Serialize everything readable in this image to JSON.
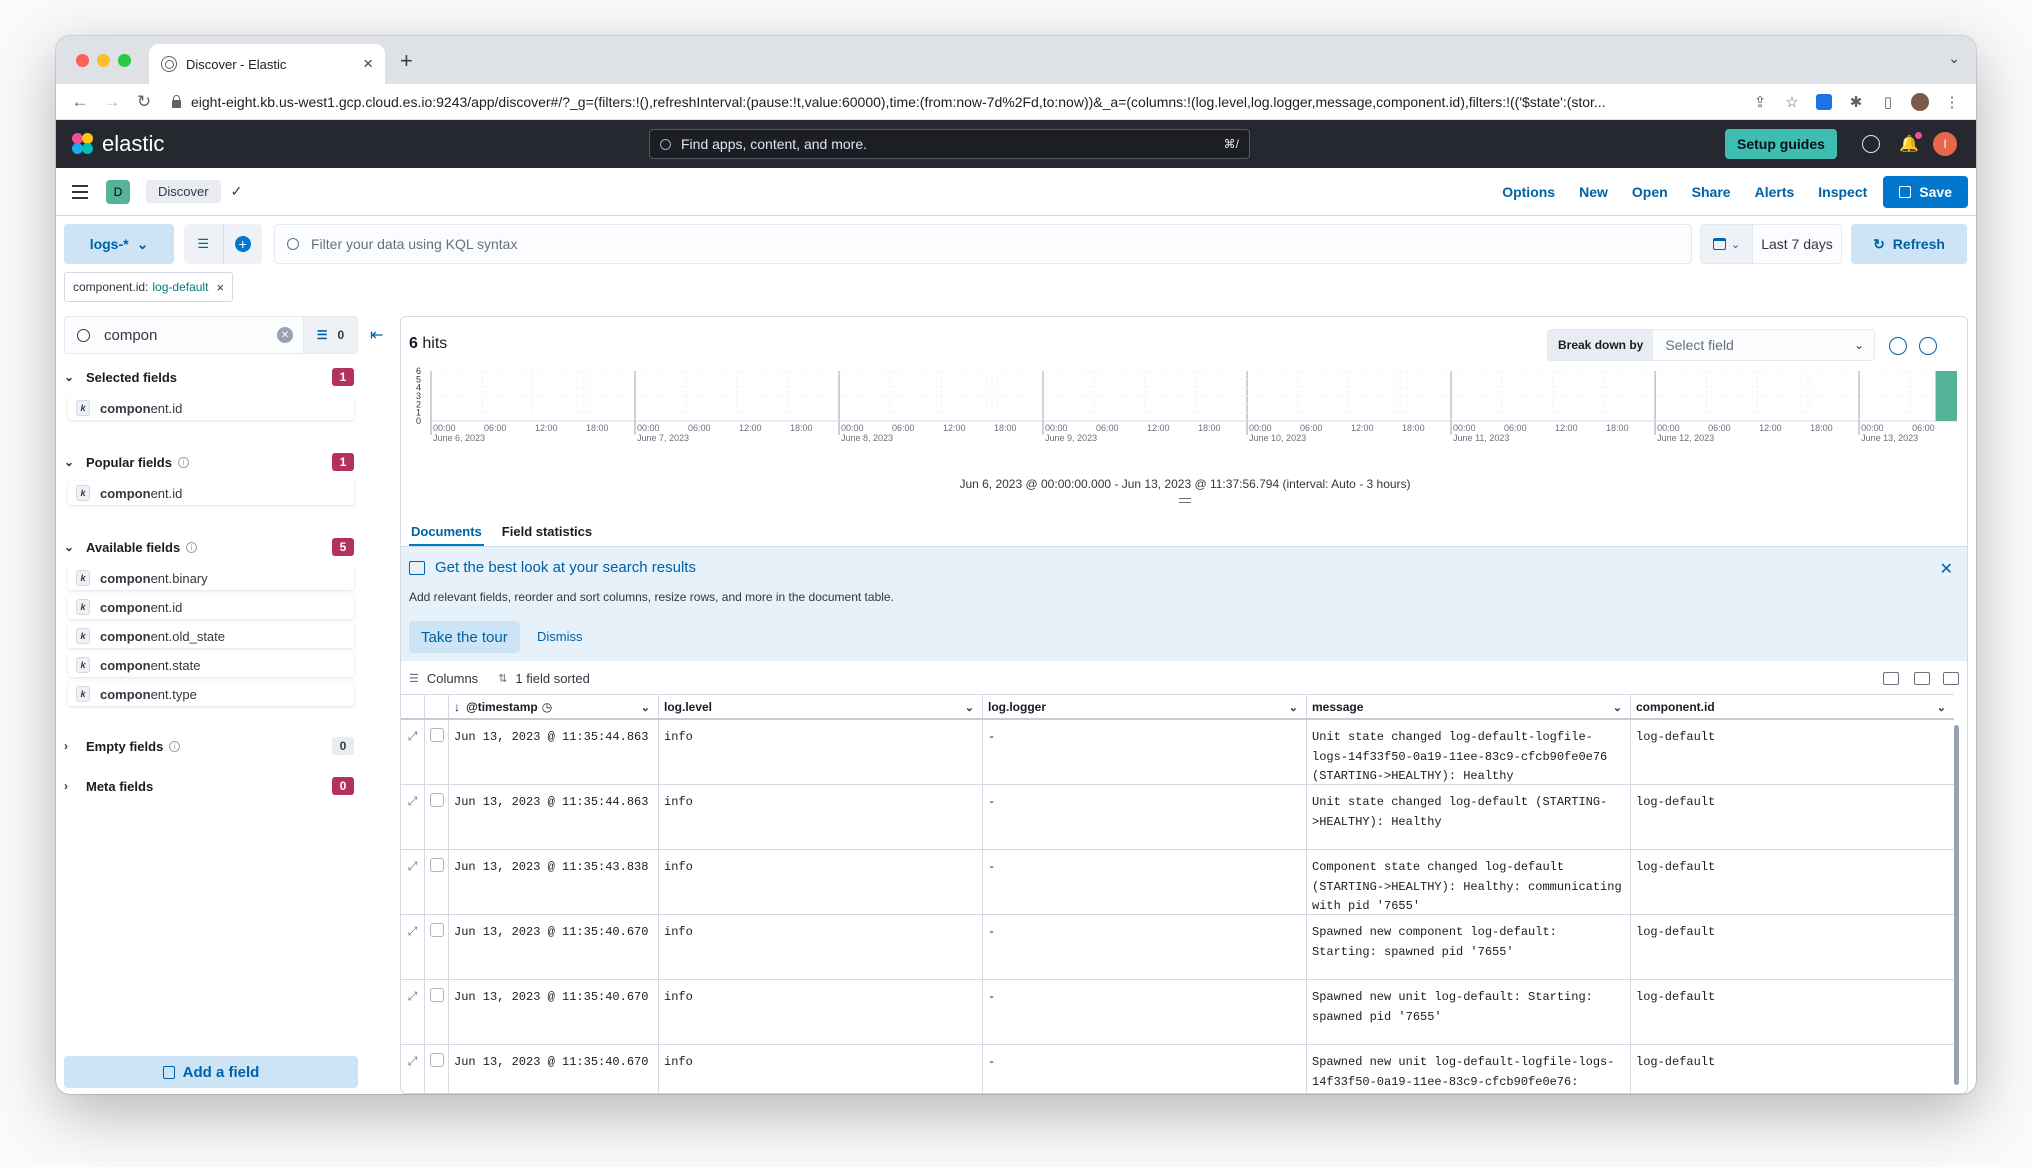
{
  "browser": {
    "tab_title": "Discover - Elastic",
    "url": "eight-eight.kb.us-west1.gcp.cloud.es.io:9243/app/discover#/?_g=(filters:!(),refreshInterval:(pause:!t,value:60000),time:(from:now-7d%2Fd,to:now))&_a=(columns:!(log.level,log.logger,message,component.id),filters:!(('$state':(stor..."
  },
  "kibana_header": {
    "brand": "elastic",
    "search_placeholder": "Find apps, content, and more.",
    "search_shortcut": "⌘/",
    "setup_guides": "Setup guides",
    "user_initial": "I"
  },
  "app_header": {
    "space_initial": "D",
    "breadcrumb": "Discover",
    "menu": [
      "Options",
      "New",
      "Open",
      "Share",
      "Alerts",
      "Inspect"
    ],
    "save_label": "Save"
  },
  "query_bar": {
    "data_view": "logs-*",
    "kql_placeholder": "Filter your data using KQL syntax",
    "time_range": "Last 7 days",
    "refresh_label": "Refresh",
    "filter_pill": {
      "field": "component.id:",
      "value": "log-default"
    }
  },
  "sidebar": {
    "search_value": "compon",
    "filter_count": "0",
    "sections": {
      "selected": {
        "title": "Selected fields",
        "count": "1",
        "fields": [
          [
            "compon",
            "ent.id"
          ]
        ]
      },
      "popular": {
        "title": "Popular fields",
        "count": "1",
        "fields": [
          [
            "compon",
            "ent.id"
          ]
        ]
      },
      "available": {
        "title": "Available fields",
        "count": "5",
        "fields": [
          [
            "compon",
            "ent.binary"
          ],
          [
            "compon",
            "ent.id"
          ],
          [
            "compon",
            "ent.old_state"
          ],
          [
            "compon",
            "ent.state"
          ],
          [
            "compon",
            "ent.type"
          ]
        ]
      },
      "empty": {
        "title": "Empty fields",
        "count": "0"
      },
      "meta": {
        "title": "Meta fields",
        "count": "0"
      }
    },
    "field_type": "k",
    "add_field": "Add a field"
  },
  "main": {
    "hits_count": "6",
    "hits_label": "hits",
    "breakdown_label": "Break down by",
    "breakdown_placeholder": "Select field",
    "interval_text": "Jun 6, 2023 @ 00:00:00.000 - Jun 13, 2023 @ 11:37:56.794 (interval: Auto - 3 hours)",
    "tabs": [
      "Documents",
      "Field statistics"
    ],
    "callout": {
      "title": "Get the best look at your search results",
      "body": "Add relevant fields, reorder and sort columns, resize rows, and more in the document table.",
      "tour": "Take the tour",
      "dismiss": "Dismiss"
    },
    "toolbar": {
      "columns": "Columns",
      "sorted": "1 field sorted"
    },
    "columns": [
      "@timestamp",
      "log.level",
      "log.logger",
      "message",
      "component.id"
    ],
    "rows": [
      {
        "ts": "Jun 13, 2023 @ 11:35:44.863",
        "level": "info",
        "logger": "-",
        "message": "Unit state changed log-default-logfile-logs-14f33f50-0a19-11ee-83c9-cfcb90fe0e76 (STARTING->HEALTHY): Healthy",
        "component": "log-default"
      },
      {
        "ts": "Jun 13, 2023 @ 11:35:44.863",
        "level": "info",
        "logger": "-",
        "message": "Unit state changed log-default (STARTING->HEALTHY): Healthy",
        "component": "log-default"
      },
      {
        "ts": "Jun 13, 2023 @ 11:35:43.838",
        "level": "info",
        "logger": "-",
        "message": "Component state changed log-default (STARTING->HEALTHY): Healthy: communicating with pid '7655'",
        "component": "log-default"
      },
      {
        "ts": "Jun 13, 2023 @ 11:35:40.670",
        "level": "info",
        "logger": "-",
        "message": "Spawned new component log-default: Starting: spawned pid '7655'",
        "component": "log-default"
      },
      {
        "ts": "Jun 13, 2023 @ 11:35:40.670",
        "level": "info",
        "logger": "-",
        "message": "Spawned new unit log-default: Starting: spawned pid '7655'",
        "component": "log-default"
      },
      {
        "ts": "Jun 13, 2023 @ 11:35:40.670",
        "level": "info",
        "logger": "-",
        "message": "Spawned new unit log-default-logfile-logs-14f33f50-0a19-11ee-83c9-cfcb90fe0e76:",
        "component": "log-default"
      }
    ]
  },
  "chart_data": {
    "type": "bar",
    "y_ticks": [
      "6",
      "5",
      "4",
      "3",
      "2",
      "1",
      "0"
    ],
    "ylim": [
      0,
      6
    ],
    "days": [
      "June 6, 2023",
      "June 7, 2023",
      "June 8, 2023",
      "June 9, 2023",
      "June 10, 2023",
      "June 11, 2023",
      "June 12, 2023",
      "June 13, 2023"
    ],
    "hour_ticks": [
      "00:00",
      "06:00",
      "12:00",
      "18:00"
    ],
    "last_day_hour_ticks": [
      "00:00",
      "06:00"
    ],
    "series": [
      {
        "x": "2023-06-13 09:00",
        "value": 6
      }
    ],
    "bar_color": "#54b399"
  }
}
